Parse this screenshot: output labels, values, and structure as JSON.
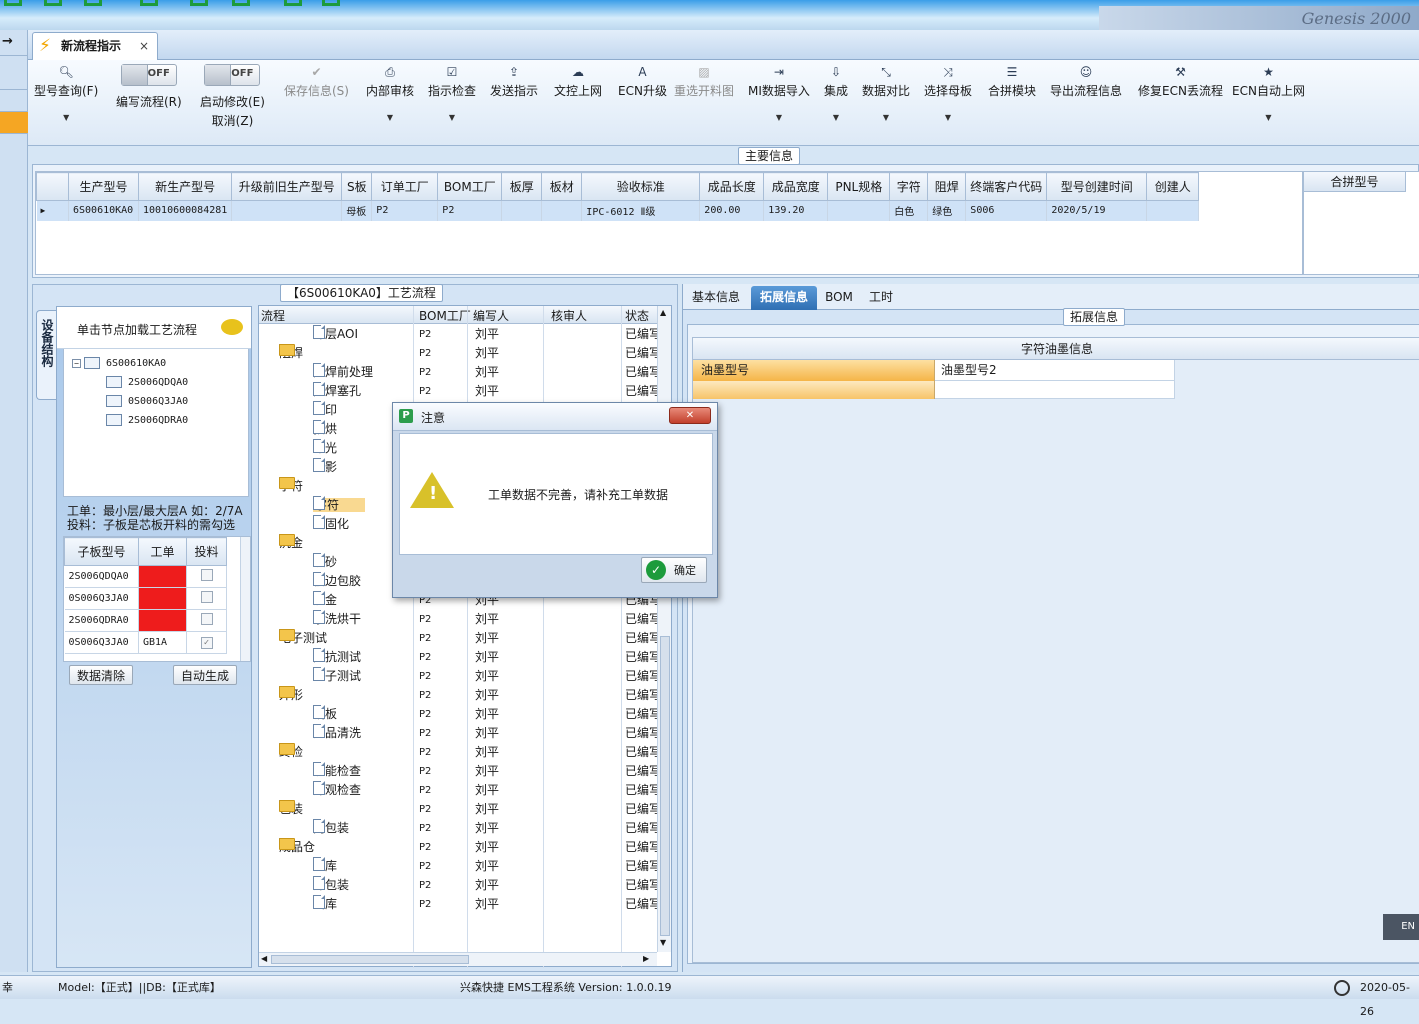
{
  "tab": {
    "label": "新流程指示",
    "close": "×"
  },
  "left_strip": [
    "→"
  ],
  "banner": "Genesis 2000",
  "toolbar": {
    "items": [
      {
        "label": "型号查询(F)",
        "icon": "search-icon",
        "glyph": "🔍︎",
        "dropdown": true,
        "enabled": true
      },
      {
        "label": "编写流程(R)",
        "toggle": "OFF",
        "enabled": true
      },
      {
        "label": "启动修改(E)",
        "label2": "取消(Z)",
        "toggle": "OFF",
        "enabled": true
      },
      {
        "label": "保存信息(S)",
        "icon": "check-icon",
        "glyph": "✔",
        "enabled": false
      },
      {
        "label": "内部审核",
        "icon": "print-icon",
        "glyph": "⎙",
        "dropdown": true,
        "enabled": true
      },
      {
        "label": "指示检查",
        "icon": "checkbox-icon",
        "glyph": "☑",
        "dropdown": true,
        "enabled": true
      },
      {
        "label": "发送指示",
        "icon": "upload-icon",
        "glyph": "⇪",
        "enabled": true
      },
      {
        "label": "文控上网",
        "icon": "cloud-upload-icon",
        "glyph": "☁",
        "enabled": true
      },
      {
        "label": "ECN升级",
        "icon": "ecn-icon",
        "glyph": "A",
        "enabled": true
      },
      {
        "label": "重选开料图",
        "icon": "image-icon",
        "glyph": "▨",
        "enabled": false
      },
      {
        "label": "MI数据导入",
        "icon": "login-icon",
        "glyph": "⇥",
        "dropdown": true,
        "enabled": true
      },
      {
        "label": "集成",
        "icon": "download-icon",
        "glyph": "⇩",
        "dropdown": true,
        "enabled": true
      },
      {
        "label": "数据对比",
        "icon": "compress-icon",
        "glyph": "⤡",
        "dropdown": true,
        "enabled": true
      },
      {
        "label": "选择母板",
        "icon": "random-icon",
        "glyph": "⤨",
        "dropdown": true,
        "enabled": true
      },
      {
        "label": "合拼模块",
        "icon": "list-icon",
        "glyph": "☰",
        "enabled": true
      },
      {
        "label": "导出流程信息",
        "icon": "smile-icon",
        "glyph": "☺",
        "enabled": true
      },
      {
        "label": "修复ECN丢流程",
        "icon": "wrench-icon",
        "glyph": "⚒",
        "enabled": true
      },
      {
        "label": "ECN自动上网",
        "icon": "star-icon",
        "glyph": "★",
        "dropdown": true,
        "enabled": true
      }
    ]
  },
  "main_info": {
    "legend": "主要信息",
    "columns": [
      "生产型号",
      "新生产型号",
      "升级前旧生产型号",
      "S板",
      "订单工厂",
      "BOM工厂",
      "板厚",
      "板材",
      "验收标准",
      "成品长度",
      "成品宽度",
      "PNL规格",
      "字符",
      "阻焊",
      "终端客户代码",
      "型号创建时间",
      "创建人"
    ],
    "row": [
      "6S00610KA0",
      "10010600084281",
      "",
      "母板",
      "P2",
      "P2",
      "",
      "",
      "IPC-6012 Ⅱ级",
      "200.00",
      "139.20",
      "",
      "白色",
      "绿色",
      "S006",
      "2020/5/19",
      ""
    ],
    "merge_header": "合拼型号"
  },
  "side_tab": "设备结构",
  "left_panel": {
    "hint": "单击节点加载工艺流程",
    "tree": {
      "root": "6S00610KA0",
      "children": [
        "2S006QDQA0",
        "0S006Q3JA0",
        "2S006QDRA0"
      ]
    },
    "note1": "工单：最小层/最大层A 如：2/7A",
    "note2": "投料：子板是芯板开料的需勾选",
    "table": {
      "columns": [
        "子板型号",
        "工单",
        "投料"
      ],
      "rows": [
        {
          "model": "2S006QDQA0",
          "work": "",
          "red": true,
          "checked": false
        },
        {
          "model": "0S006Q3JA0",
          "work": "",
          "red": true,
          "checked": false
        },
        {
          "model": "2S006QDRA0",
          "work": "",
          "red": true,
          "checked": false
        },
        {
          "model": "0S006Q3JA0",
          "work": "GB1A",
          "red": false,
          "checked": true
        }
      ]
    },
    "btn_clear": "数据清除",
    "btn_auto": "自动生成"
  },
  "process": {
    "legend": "【6S00610KA0】工艺流程",
    "columns": [
      "流程",
      "BOM工厂",
      "编写人",
      "核审人",
      "状态"
    ],
    "rows": [
      {
        "name": "外层AOI",
        "level": 2,
        "folder": false,
        "bom": "P2",
        "writer": "刘平",
        "status": "已编写"
      },
      {
        "name": "阻焊",
        "level": 1,
        "folder": true,
        "bom": "P2",
        "writer": "刘平",
        "status": "已编写"
      },
      {
        "name": "阻焊前处理",
        "level": 2,
        "folder": false,
        "bom": "P2",
        "writer": "刘平",
        "status": "已编写"
      },
      {
        "name": "阻焊塞孔",
        "level": 2,
        "folder": false,
        "bom": "P2",
        "writer": "刘平",
        "status": "已编写"
      },
      {
        "name": "丝印",
        "level": 2,
        "folder": false,
        "bom": "",
        "writer": "",
        "status": ""
      },
      {
        "name": "预烘",
        "level": 2,
        "folder": false,
        "bom": "",
        "writer": "",
        "status": ""
      },
      {
        "name": "曝光",
        "level": 2,
        "folder": false,
        "bom": "",
        "writer": "",
        "status": ""
      },
      {
        "name": "显影",
        "level": 2,
        "folder": false,
        "bom": "",
        "writer": "",
        "status": ""
      },
      {
        "name": "字符",
        "level": 1,
        "folder": true,
        "bom": "",
        "writer": "",
        "status": ""
      },
      {
        "name": "字符",
        "level": 2,
        "folder": false,
        "bom": "",
        "writer": "",
        "status": "",
        "selected": true
      },
      {
        "name": "终固化",
        "level": 2,
        "folder": false,
        "bom": "",
        "writer": "",
        "status": ""
      },
      {
        "name": "沉金",
        "level": 1,
        "folder": true,
        "bom": "",
        "writer": "",
        "status": ""
      },
      {
        "name": "喷砂",
        "level": 2,
        "folder": false,
        "bom": "",
        "writer": "",
        "status": ""
      },
      {
        "name": "板边包胶",
        "level": 2,
        "folder": false,
        "bom": "",
        "writer": "",
        "status": ""
      },
      {
        "name": "沉金",
        "level": 2,
        "folder": false,
        "bom": "P2",
        "writer": "刘平",
        "status": "已编写"
      },
      {
        "name": "水洗烘干",
        "level": 2,
        "folder": false,
        "bom": "P2",
        "writer": "刘平",
        "status": "已编写"
      },
      {
        "name": "电子测试",
        "level": 1,
        "folder": true,
        "bom": "P2",
        "writer": "刘平",
        "status": "已编写"
      },
      {
        "name": "阻抗测试",
        "level": 2,
        "folder": false,
        "bom": "P2",
        "writer": "刘平",
        "status": "已编写"
      },
      {
        "name": "电子测试",
        "level": 2,
        "folder": false,
        "bom": "P2",
        "writer": "刘平",
        "status": "已编写"
      },
      {
        "name": "外形",
        "level": 1,
        "folder": true,
        "bom": "P2",
        "writer": "刘平",
        "status": "已编写"
      },
      {
        "name": "铣板",
        "level": 2,
        "folder": false,
        "bom": "P2",
        "writer": "刘平",
        "status": "已编写"
      },
      {
        "name": "成品清洗",
        "level": 2,
        "folder": false,
        "bom": "P2",
        "writer": "刘平",
        "status": "已编写"
      },
      {
        "name": "终检",
        "level": 1,
        "folder": true,
        "bom": "P2",
        "writer": "刘平",
        "status": "已编写"
      },
      {
        "name": "功能检查",
        "level": 2,
        "folder": false,
        "bom": "P2",
        "writer": "刘平",
        "status": "已编写"
      },
      {
        "name": "外观检查",
        "level": 2,
        "folder": false,
        "bom": "P2",
        "writer": "刘平",
        "status": "已编写"
      },
      {
        "name": "包装",
        "level": 1,
        "folder": true,
        "bom": "P2",
        "writer": "刘平",
        "status": "已编写"
      },
      {
        "name": "内包装",
        "level": 2,
        "folder": false,
        "bom": "P2",
        "writer": "刘平",
        "status": "已编写"
      },
      {
        "name": "成品仓",
        "level": 1,
        "folder": true,
        "bom": "P2",
        "writer": "刘平",
        "status": "已编写"
      },
      {
        "name": "入库",
        "level": 2,
        "folder": false,
        "bom": "P2",
        "writer": "刘平",
        "status": "已编写"
      },
      {
        "name": "外包装",
        "level": 2,
        "folder": false,
        "bom": "P2",
        "writer": "刘平",
        "status": "已编写"
      },
      {
        "name": "出库",
        "level": 2,
        "folder": false,
        "bom": "P2",
        "writer": "刘平",
        "status": "已编写"
      }
    ]
  },
  "right_panel": {
    "tabs": [
      "基本信息",
      "拓展信息",
      "BOM",
      "工时"
    ],
    "active_tab": 1,
    "legend": "拓展信息",
    "grid_title": "字符油墨信息",
    "col1": "油墨型号",
    "col2": "油墨型号2",
    "lang": "EN"
  },
  "dialog": {
    "title": "注意",
    "message": "工单数据不完善，请补充工单数据",
    "ok": "确定",
    "close": "✕"
  },
  "status": {
    "left": "幸",
    "model": "Model:【正式】||DB:【正式库】",
    "center": "兴森快捷 EMS工程系统 Version: 1.0.0.19",
    "date": "2020-05-26"
  }
}
